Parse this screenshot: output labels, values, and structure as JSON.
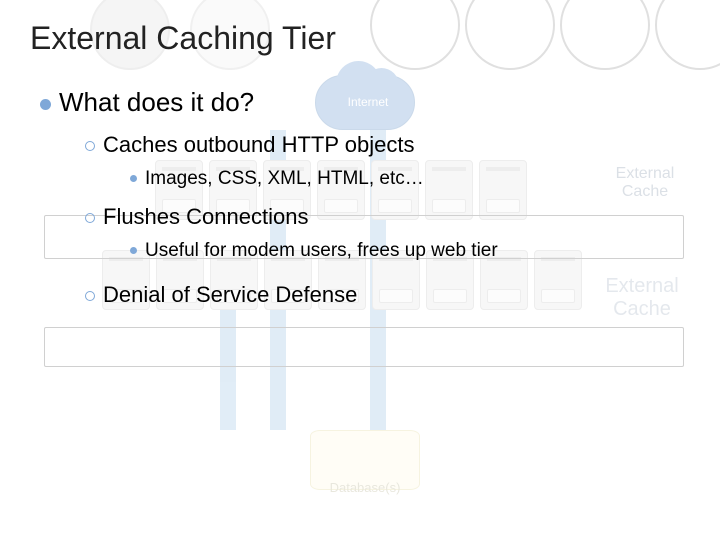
{
  "title": "External Caching Tier",
  "l1": {
    "what": "What does it do?"
  },
  "l2": {
    "caches": "Caches outbound HTTP objects",
    "flushes": "Flushes Connections",
    "denial": "Denial of Service Defense"
  },
  "l3": {
    "images": "Images, CSS, XML, HTML, etc…",
    "useful": "Useful for modem users, frees up web tier"
  },
  "bg": {
    "internet": "Internet",
    "external_cache": "External Cache",
    "external_cache2": "External Cache",
    "databases": "Database(s)"
  }
}
